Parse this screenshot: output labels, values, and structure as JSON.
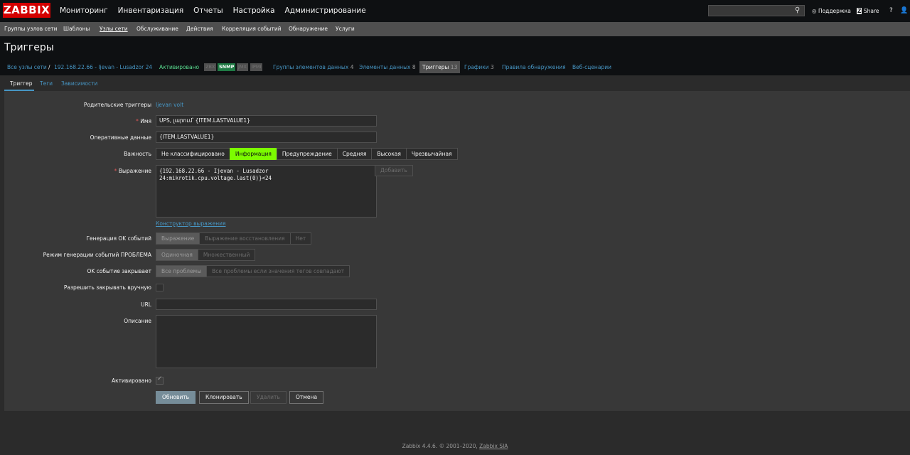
{
  "app": {
    "logo": "ZABBIX"
  },
  "main_menu": [
    "Мониторинг",
    "Инвентаризация",
    "Отчеты",
    "Настройка",
    "Администрирование"
  ],
  "top_links": {
    "support": "Поддержка",
    "share": "Share",
    "help": "?",
    "user_icon": "user-icon",
    "logout_icon": "power-icon"
  },
  "search": {
    "value": "",
    "placeholder": ""
  },
  "sub_menu": [
    "Группы узлов сети",
    "Шаблоны",
    "Узлы сети",
    "Обслуживание",
    "Действия",
    "Корреляция событий",
    "Обнаружение",
    "Услуги"
  ],
  "page": {
    "title": "Триггеры"
  },
  "breadcrumbs": {
    "all_hosts": "Все узлы сети",
    "sep": "/",
    "host": "192.168.22.66 - Ijevan - Lusadzor 24",
    "status": "Активировано",
    "avail": [
      "ZBX",
      "SNMP",
      "JMX",
      "IPMI"
    ],
    "links": [
      {
        "label": "Группы элементов данных",
        "count": "4"
      },
      {
        "label": "Элементы данных",
        "count": "8"
      },
      {
        "label": "Триггеры",
        "count": "13"
      },
      {
        "label": "Графики",
        "count": "3"
      },
      {
        "label": "Правила обнаружения",
        "count": ""
      },
      {
        "label": "Веб-сценарии",
        "count": ""
      }
    ]
  },
  "form_tabs": [
    "Триггер",
    "Теги",
    "Зависимости"
  ],
  "form": {
    "parent_label": "Родительские триггеры",
    "parent_value": "Ijevan volt",
    "required_mark": "*",
    "name_label": "Имя",
    "name_value": "UPS, լարում՝ {ITEM.LASTVALUE1}",
    "opdata_label": "Оперативные данные",
    "opdata_value": "{ITEM.LASTVALUE1}",
    "severity_label": "Важность",
    "severity": [
      "Не классифицировано",
      "Информация",
      "Предупреждение",
      "Средняя",
      "Высокая",
      "Чрезвычайная"
    ],
    "severity_selected": "Информация",
    "expression_label": "Выражение",
    "expression_line1": "{192.168.22.66 - Ijevan - Lusadzor",
    "expression_line2": "24:mikrotik.cpu.voltage.last(0)}<24",
    "add_button": "Добавить",
    "constructor_link": "Конструктор выражения",
    "ok_gen_label": "Генерация OK событий",
    "ok_gen": [
      "Выражение",
      "Выражение восстановления",
      "Нет"
    ],
    "problem_mode_label": "Режим генерации событий ПРОБЛЕМА",
    "problem_mode": [
      "Одиночная",
      "Множественный"
    ],
    "ok_closes_label": "OK событие закрывает",
    "ok_closes": [
      "Все проблемы",
      "Все проблемы если значения тегов совпадают"
    ],
    "manual_close_label": "Разрешить закрывать вручную",
    "url_label": "URL",
    "url_value": "",
    "desc_label": "Описание",
    "desc_value": "",
    "enabled_label": "Активировано"
  },
  "buttons": {
    "update": "Обновить",
    "clone": "Клонировать",
    "delete": "Удалить",
    "cancel": "Отмена"
  },
  "footer": {
    "text": "Zabbix 4.4.6. © 2001–2020,",
    "link": "Zabbix SIA"
  },
  "colors": {
    "logo": "#d40000",
    "info_severity": "#7cfc00",
    "link": "#4796c4",
    "status_green": "#59db8f"
  }
}
